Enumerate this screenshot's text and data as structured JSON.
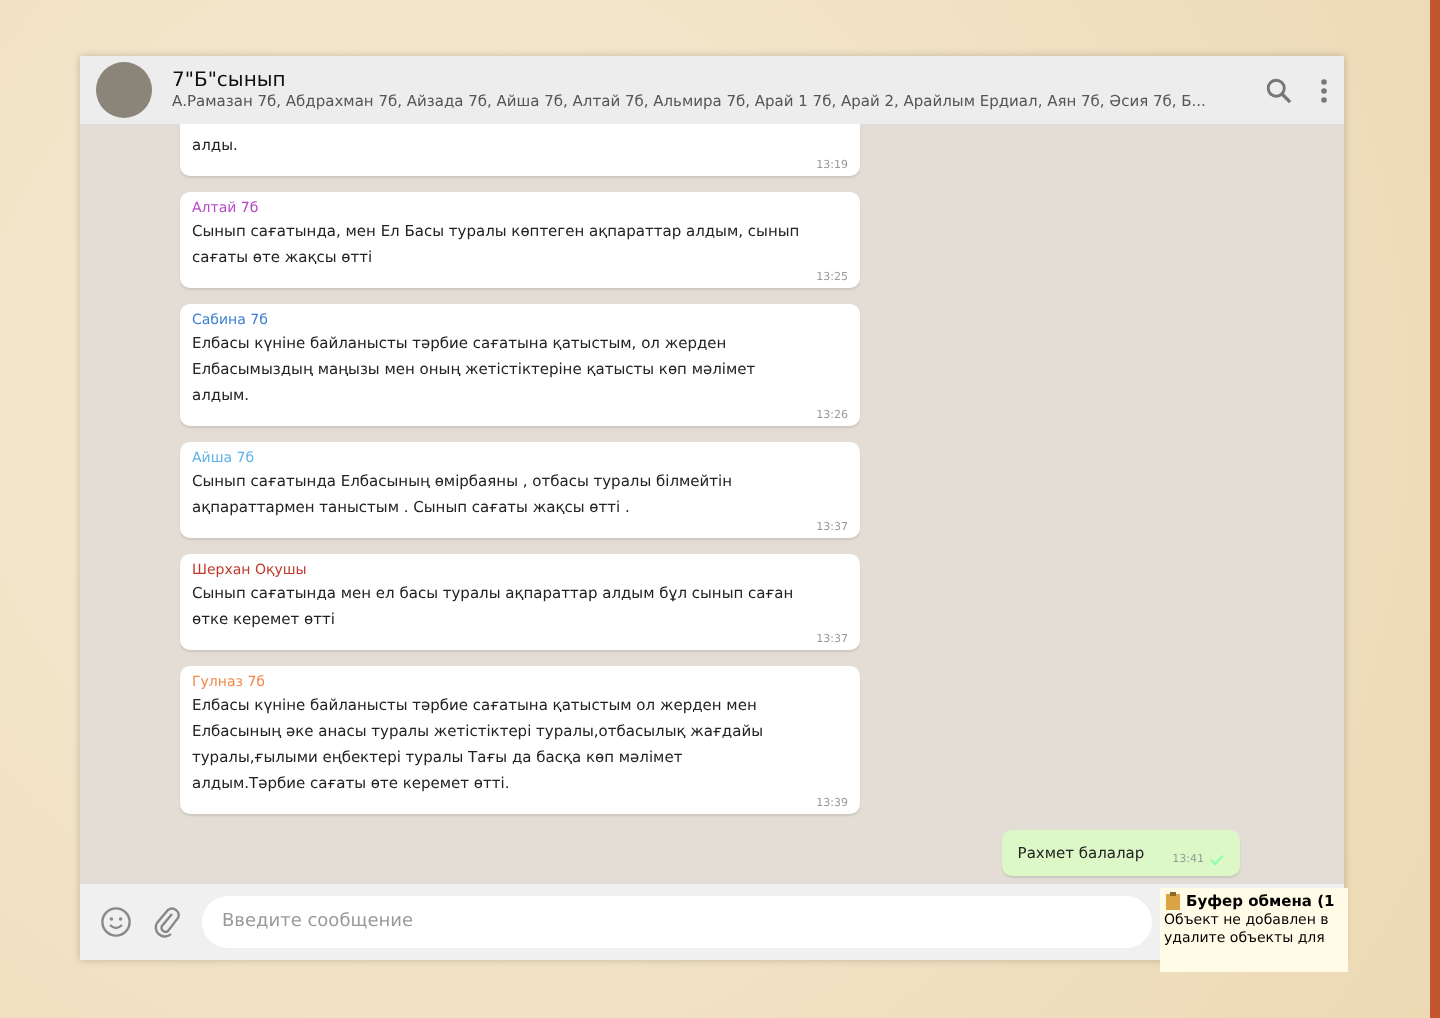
{
  "chat": {
    "title": "7\"Б\"сынып",
    "members": "А.Рамазан 7б, Абдрахман 7б, Айзада 7б, Айша 7б, Алтай 7б, Альмира 7б, Арай 1 7б, Арай 2, Арайлым Ердиал, Аян 7б, Әсия 7б, Б..."
  },
  "messages": [
    {
      "kind": "incoming",
      "text": "алды.",
      "time": "13:19"
    },
    {
      "kind": "incoming",
      "sender": "Алтай 7б",
      "color": "#b548c6",
      "text": "Сынып сағатында, мен Ел Басы туралы көптеген ақпараттар алдым, сынып сағаты өте жақсы өтті",
      "time": "13:25"
    },
    {
      "kind": "incoming",
      "sender": "Сабина 7б",
      "color": "#3b7fd4",
      "text": "Елбасы күніне байланысты тәрбие сағатына қатыстым, ол жерден Елбасымыздың маңызы мен оның жетістіктеріне қатысты көп мәлімет алдым.",
      "time": "13:26"
    },
    {
      "kind": "incoming",
      "sender": "Айша 7б",
      "color": "#5fb3e6",
      "text": "Сынып сағатында Елбасының өмірбаяны , отбасы туралы білмейтін ақпараттармен таныстым .  Сынып сағаты жақсы өтті .",
      "time": "13:37"
    },
    {
      "kind": "incoming",
      "sender": "Шерхан Оқушы",
      "color": "#c0392b",
      "text": "Сынып сағатында мен ел басы туралы ақпараттар алдым бұл сынып саған өтке керемет өтті",
      "time": "13:37"
    },
    {
      "kind": "incoming",
      "sender": "Гулназ 7б",
      "color": "#f0884a",
      "text": "Елбасы күніне байланысты тәрбие сағатына қатыстым ол жерден мен Елбасының әке анасы туралы жетістіктері туралы,отбасылық жағдайы туралы,ғылыми еңбектері туралы Тағы да басқа көп мәлімет алдым.Тәрбие сағаты өте керемет өтті.",
      "time": "13:39"
    },
    {
      "kind": "outgoing",
      "text": "Рахмет балалар",
      "time": "13:41"
    }
  ],
  "composer": {
    "placeholder": "Введите сообщение"
  },
  "clipboard_popup": {
    "title": "Буфер обмена (1",
    "lines": [
      "Объект не добавлен в",
      "удалите объекты для"
    ]
  }
}
